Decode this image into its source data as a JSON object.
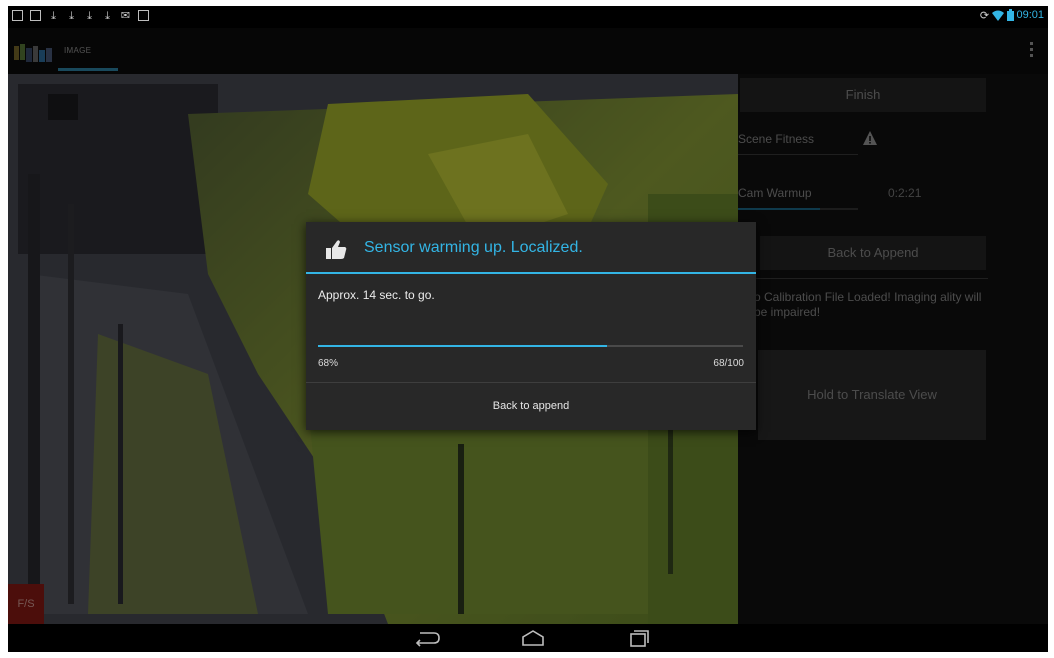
{
  "status_bar": {
    "left_icons": [
      "screenshot-icon",
      "screenshot-icon",
      "download-icon",
      "download-icon",
      "download-icon",
      "download-icon",
      "gmail-icon",
      "image-icon"
    ],
    "right_icons": [
      "sync-icon",
      "wifi-icon",
      "battery-icon"
    ],
    "time": "09:01"
  },
  "action_bar": {
    "tab_label": "IMAGE"
  },
  "side_panel": {
    "finish_label": "Finish",
    "scene_fitness_label": "Scene Fitness",
    "cam_warmup_label": "Cam Warmup",
    "cam_warmup_time": "0:2:21",
    "back_to_append_label": "Back to Append",
    "calibration_warning": "o Calibration File Loaded! Imaging ality will be impaired!",
    "translate_view_label": "Hold to Translate View"
  },
  "camera_view": {
    "fs_label": "F/S"
  },
  "dialog": {
    "title": "Sensor warming up. Localized.",
    "message": "Approx. 14 sec. to go.",
    "progress_percent": "68%",
    "progress_count": "68/100",
    "progress_value": 0.68,
    "button_label": "Back to append"
  },
  "colors": {
    "accent": "#33b5e5",
    "fs_button": "#8a1a14"
  }
}
